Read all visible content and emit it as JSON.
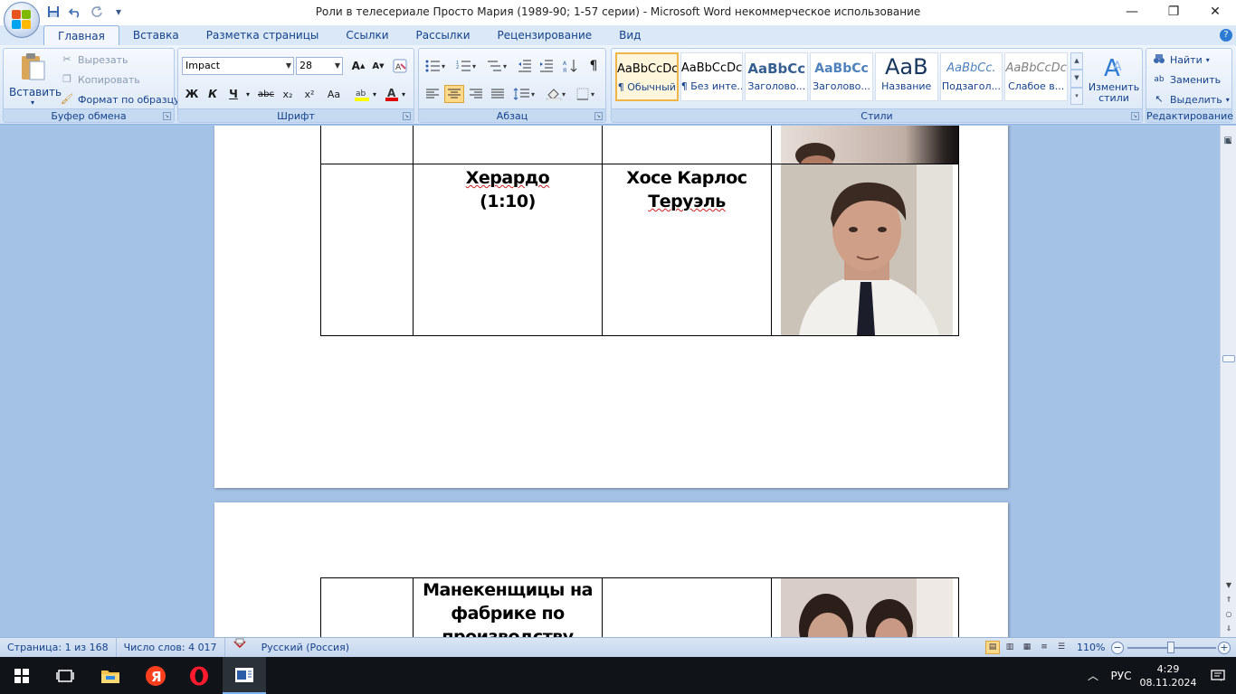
{
  "window": {
    "title": "Роли в телесериале Просто Мария (1989-90; 1-57 серии)  -  Microsoft Word некоммерческое использование",
    "minimize": "—",
    "maximize": "❐",
    "close": "✕"
  },
  "qat": {
    "save_icon": "save-icon",
    "undo_icon": "undo-icon",
    "redo_icon": "redo-icon",
    "customize": "▾"
  },
  "tabs": [
    "Главная",
    "Вставка",
    "Разметка страницы",
    "Ссылки",
    "Рассылки",
    "Рецензирование",
    "Вид"
  ],
  "ribbon": {
    "clipboard": {
      "label": "Буфер обмена",
      "paste": "Вставить",
      "cut": "Вырезать",
      "copy": "Копировать",
      "format_painter": "Формат по образцу"
    },
    "font": {
      "label": "Шрифт",
      "family": "Impact",
      "size": "28",
      "bold": "Ж",
      "italic": "К",
      "underline": "Ч",
      "strike": "abc",
      "subscript": "x₂",
      "superscript": "x²",
      "case": "Aa"
    },
    "paragraph": {
      "label": "Абзац",
      "pilcrow": "¶"
    },
    "styles": {
      "label": "Стили",
      "items": [
        {
          "sample": "AaBbCcDc",
          "name": "¶ Обычный"
        },
        {
          "sample": "AaBbCcDc",
          "name": "¶ Без инте..."
        },
        {
          "sample": "AaBbCc",
          "name": "Заголово..."
        },
        {
          "sample": "AaBbCc",
          "name": "Заголово..."
        },
        {
          "sample": "AaB",
          "name": "Название"
        },
        {
          "sample": "AaBbCc.",
          "name": "Подзагол..."
        },
        {
          "sample": "AaBbCcDc",
          "name": "Слабое в..."
        }
      ],
      "change_styles": "Изменить стили"
    },
    "editing": {
      "label": "Редактирование",
      "find": "Найти",
      "replace": "Заменить",
      "select": "Выделить"
    }
  },
  "document": {
    "rows": [
      {
        "role": "Херардо (1:10)",
        "role_line1": "Херардо",
        "role_line2": "(1:10)",
        "actor_line1": "Хосе Карлос",
        "actor_line2": "Теруэль"
      },
      {
        "role_line1": "Манекенщицы на",
        "role_line2": "фабрике по",
        "role_line3": "производству"
      }
    ]
  },
  "statusbar": {
    "page": "Страница: 1 из 168",
    "words": "Число слов: 4 017",
    "language": "Русский (Россия)",
    "zoom": "110%"
  },
  "taskbar": {
    "lang": "РУС",
    "time": "4:29",
    "date": "08.11.2024"
  },
  "colors": {
    "ribbon_text": "#15428b",
    "doc_background": "#a4c1e6",
    "taskbar": "#101418"
  }
}
